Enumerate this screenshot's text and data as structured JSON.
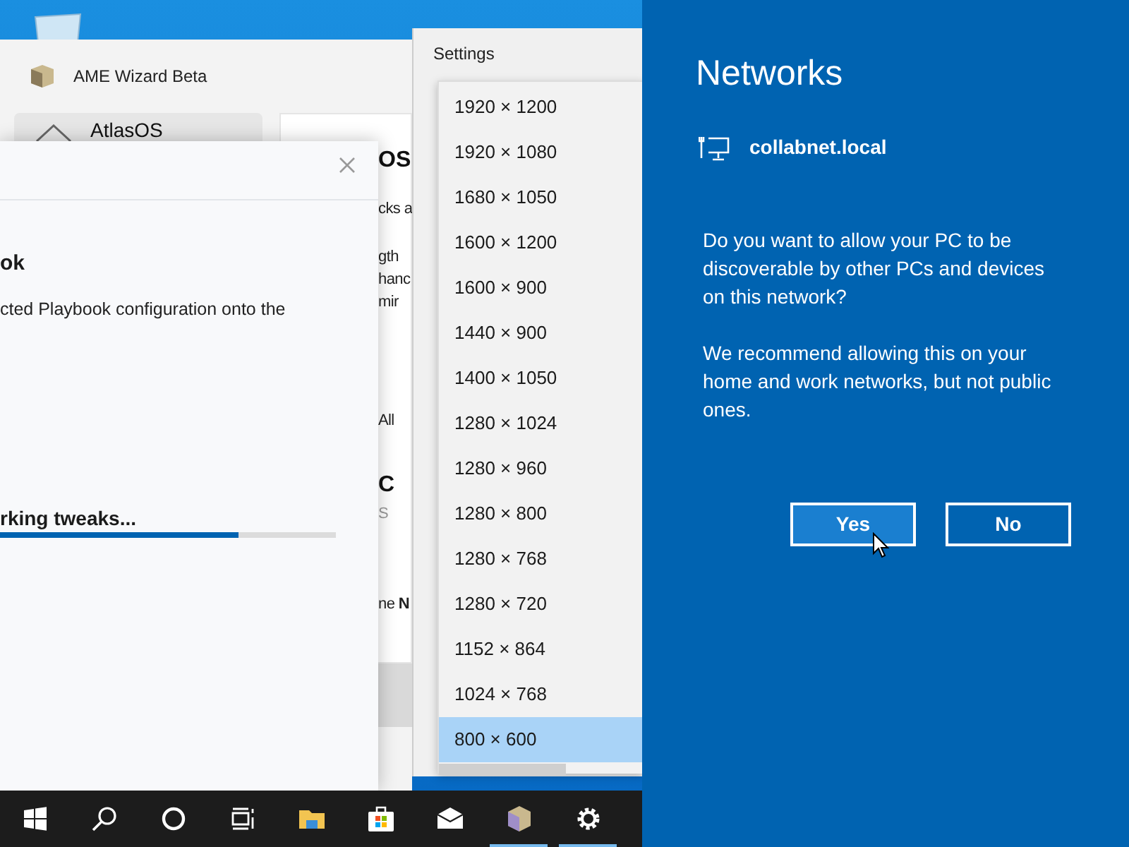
{
  "ame_window": {
    "title": "AME Wizard Beta",
    "sidebar_items": [
      {
        "label": "AtlasOS",
        "selected": true
      }
    ],
    "card_fragments": [
      {
        "text": "OS",
        "kind": "heading"
      },
      {
        "text": "cks a",
        "kind": "body"
      },
      {
        "text": "gth",
        "kind": "body"
      },
      {
        "text": "hanc",
        "kind": "body"
      },
      {
        "text": "mir",
        "kind": "body"
      },
      {
        "text": "All",
        "kind": "body"
      },
      {
        "text": "C",
        "kind": "heading"
      },
      {
        "text": "S",
        "kind": "muted"
      },
      {
        "text": "ne **N**",
        "kind": "body"
      }
    ]
  },
  "progress_dialog": {
    "heading": "ok",
    "description": "cted Playbook configuration onto the",
    "status": "rking tweaks...",
    "level": 0.71
  },
  "settings_window": {
    "title": "Settings",
    "resolution_options": [
      {
        "label": "1920 × 1200",
        "selected": false
      },
      {
        "label": "1920 × 1080",
        "selected": false
      },
      {
        "label": "1680 × 1050",
        "selected": false
      },
      {
        "label": "1600 × 1200",
        "selected": false
      },
      {
        "label": "1600 × 900",
        "selected": false
      },
      {
        "label": "1440 × 900",
        "selected": false
      },
      {
        "label": "1400 × 1050",
        "selected": false
      },
      {
        "label": "1280 × 1024",
        "selected": false
      },
      {
        "label": "1280 × 960",
        "selected": false
      },
      {
        "label": "1280 × 800",
        "selected": false
      },
      {
        "label": "1280 × 768",
        "selected": false
      },
      {
        "label": "1280 × 720",
        "selected": false
      },
      {
        "label": "1152 × 864",
        "selected": false
      },
      {
        "label": "1024 × 768",
        "selected": false
      },
      {
        "label": "800 × 600",
        "selected": true
      }
    ]
  },
  "network_panel": {
    "title": "Networks",
    "network_name": "collabnet.local",
    "paragraphs": [
      "Do you want to allow your PC to be discoverable by other PCs and devices on this network?",
      "We recommend allowing this on your home and work networks, but not public ones."
    ],
    "buttons": [
      {
        "label": "Yes",
        "hovered": true
      },
      {
        "label": "No",
        "hovered": false
      }
    ]
  },
  "taskbar": {
    "items": [
      {
        "kind": "start",
        "active": false
      },
      {
        "kind": "search",
        "active": false
      },
      {
        "kind": "cortana",
        "active": false
      },
      {
        "kind": "task-view",
        "active": false
      },
      {
        "kind": "explorer",
        "active": false
      },
      {
        "kind": "store",
        "active": false
      },
      {
        "kind": "mail",
        "active": false
      },
      {
        "kind": "ame",
        "active": true
      },
      {
        "kind": "settings",
        "active": true
      }
    ]
  }
}
